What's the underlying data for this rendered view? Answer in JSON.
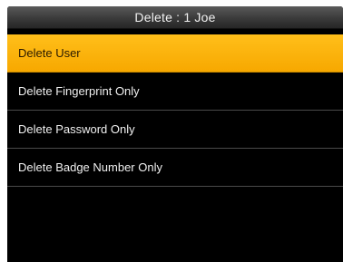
{
  "title_bar": {
    "title": "Delete : 1 Joe"
  },
  "menu": {
    "selected_index": 0,
    "items": [
      {
        "label": "Delete User"
      },
      {
        "label": "Delete Fingerprint Only"
      },
      {
        "label": "Delete Password Only"
      },
      {
        "label": "Delete Badge Number Only"
      }
    ]
  },
  "colors": {
    "selection": "#f7a800",
    "screen_background": "#000000",
    "title_bar": "#3a3a3a"
  }
}
